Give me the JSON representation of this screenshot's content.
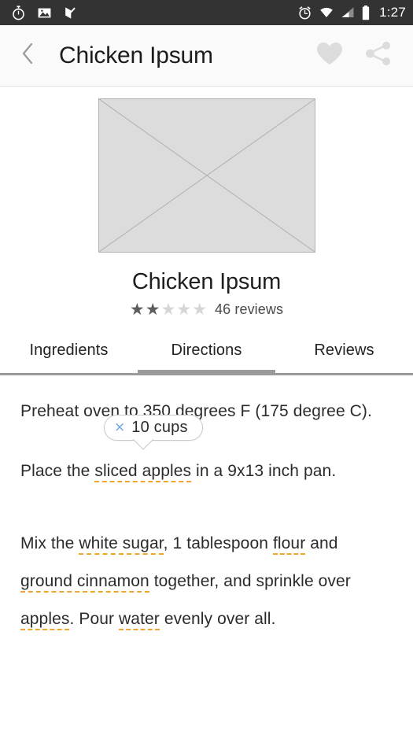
{
  "status_bar": {
    "left_icons": [
      "stopwatch-icon",
      "image-icon",
      "flag-check-icon"
    ],
    "right_icons": [
      "alarm-icon",
      "wifi-icon",
      "cell-signal-icon",
      "battery-icon"
    ],
    "time": "1:27",
    "background_color": "#333333"
  },
  "app_bar": {
    "back_icon": "chevron-left-icon",
    "title": "Chicken Ipsum",
    "actions": [
      {
        "icon": "heart-icon",
        "name": "favorite-button"
      },
      {
        "icon": "share-icon",
        "name": "share-button"
      }
    ],
    "icon_color": "#dcdcdc"
  },
  "hero": {
    "image_alt": "recipe-image-placeholder",
    "title": "Chicken Ipsum",
    "rating": {
      "value": 2,
      "max": 5,
      "filled_color": "#5d5d5d",
      "empty_color": "#d6d6d6",
      "star_glyph": "★"
    },
    "reviews_label": "46 reviews"
  },
  "tabs": {
    "active_index": 1,
    "indicator_color": "#9a9a9a",
    "items": [
      {
        "label": "Ingredients",
        "name": "tab-ingredients"
      },
      {
        "label": "Directions",
        "name": "tab-directions"
      },
      {
        "label": "Reviews",
        "name": "tab-reviews"
      }
    ]
  },
  "tooltip": {
    "close_glyph": "×",
    "close_color": "#6aa3e0",
    "label": "10 cups"
  },
  "directions": {
    "accent_color": "#f0a62e",
    "paragraph_1": {
      "text": "Preheat oven to 350 degrees F (175 degree C)."
    },
    "paragraph_2": {
      "before": "Place the ",
      "ingredient_1": "sliced apples",
      "after": " in a 9x13 inch pan."
    },
    "paragraph_3": {
      "seg_1": "Mix the ",
      "ingredient_1": "white sugar",
      "seg_2": ", 1 tablespoon ",
      "ingredient_2": "flour",
      "seg_3": " and ",
      "ingredient_3": "ground cinnamon",
      "seg_4": " together, and sprinkle over ",
      "ingredient_4": "apples",
      "seg_5": ". Pour ",
      "ingredient_5": "water",
      "seg_6": " evenly over all."
    }
  }
}
